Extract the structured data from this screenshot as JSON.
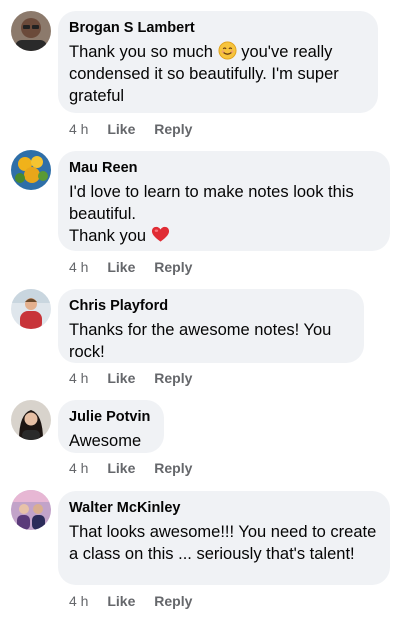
{
  "comments": [
    {
      "author": "Brogan S Lambert",
      "text_before": "Thank you so much",
      "emoji": "smiling-face-emoji",
      "text_after": "you've really condensed it so beautifully. I'm super grateful",
      "timestamp": "4 h",
      "like_label": "Like",
      "reply_label": "Reply"
    },
    {
      "author": "Mau Reen",
      "line1": "I'd love to learn to make notes look this beautiful.",
      "line2": "Thank you",
      "emoji": "red-heart-emoji",
      "timestamp": "4 h",
      "like_label": "Like",
      "reply_label": "Reply"
    },
    {
      "author": "Chris Playford",
      "text": "Thanks for the awesome notes! You rock!",
      "timestamp": "4 h",
      "like_label": "Like",
      "reply_label": "Reply"
    },
    {
      "author": "Julie Potvin",
      "text": "Awesome",
      "timestamp": "4 h",
      "like_label": "Like",
      "reply_label": "Reply"
    },
    {
      "author": "Walter McKinley",
      "text": "That looks awesome!!! You need to create a class on this ... seriously that's talent!",
      "timestamp": "4 h",
      "like_label": "Like",
      "reply_label": "Reply"
    }
  ],
  "colors": {
    "bubble": "#f0f2f5",
    "meta_text": "#65676b",
    "body_text": "#050505"
  }
}
